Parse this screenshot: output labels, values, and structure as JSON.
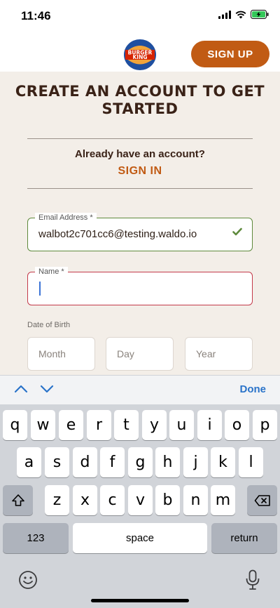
{
  "status_bar": {
    "time": "11:46"
  },
  "header": {
    "logo_alt": "BURGER KING",
    "signup_label": "SIGN UP"
  },
  "main": {
    "title": "CREATE AN ACCOUNT TO GET STARTED",
    "already_text": "Already have an account?",
    "signin_label": "SIGN IN",
    "email": {
      "label": "Email Address *",
      "value": "walbot2c701cc6@testing.waldo.io"
    },
    "name": {
      "label": "Name *",
      "value": ""
    },
    "dob": {
      "label": "Date of Birth",
      "month_placeholder": "Month",
      "day_placeholder": "Day",
      "year_placeholder": "Year"
    }
  },
  "keyboard_toolbar": {
    "done_label": "Done"
  },
  "keyboard": {
    "row1": [
      "q",
      "w",
      "e",
      "r",
      "t",
      "y",
      "u",
      "i",
      "o",
      "p"
    ],
    "row2": [
      "a",
      "s",
      "d",
      "f",
      "g",
      "h",
      "j",
      "k",
      "l"
    ],
    "row3": [
      "z",
      "x",
      "c",
      "v",
      "b",
      "n",
      "m"
    ],
    "numbers_label": "123",
    "space_label": "space",
    "return_label": "return"
  },
  "colors": {
    "brand_orange": "#c15b14",
    "valid_green": "#5e8a3c",
    "error_red": "#c33a4a",
    "background": "#f3eee8"
  }
}
